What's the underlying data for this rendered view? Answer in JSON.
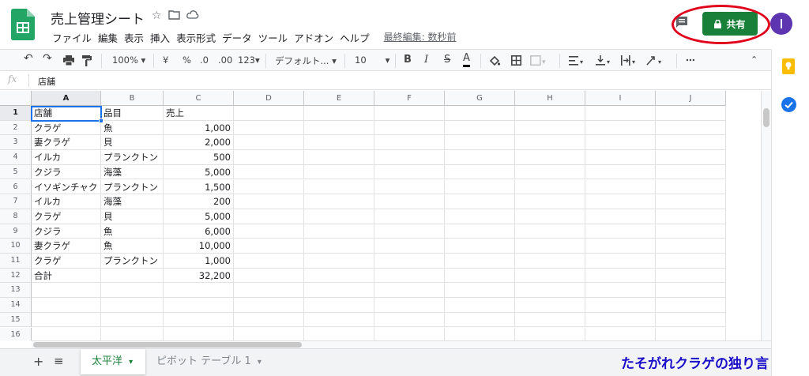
{
  "app": {
    "title": "売上管理シート"
  },
  "menu": [
    "ファイル",
    "編集",
    "表示",
    "挿入",
    "表示形式",
    "データ",
    "ツール",
    "アドオン",
    "ヘルプ"
  ],
  "last_edit": "最終編集: 数秒前",
  "share_label": "共有",
  "toolbar": {
    "zoom": "100%",
    "currency": "¥",
    "percent": "%",
    "dec_less": ".0",
    "dec_more": ".00",
    "format": "123",
    "font": "デフォルト...",
    "font_size": "10",
    "bold": "B",
    "italic": "I",
    "strike": "S",
    "color": "A"
  },
  "formula": {
    "label": "fx",
    "value": "店舗"
  },
  "columns": [
    "A",
    "B",
    "C",
    "D",
    "E",
    "F",
    "G",
    "H",
    "I",
    "J"
  ],
  "rows": [
    "1",
    "2",
    "3",
    "4",
    "5",
    "6",
    "7",
    "8",
    "9",
    "10",
    "11",
    "12",
    "13",
    "14",
    "15",
    "16"
  ],
  "cells": [
    [
      "店舗",
      "品目",
      "売上"
    ],
    [
      "クラゲ",
      "魚",
      "1,000"
    ],
    [
      "妻クラゲ",
      "貝",
      "2,000"
    ],
    [
      "イルカ",
      "プランクトン",
      "500"
    ],
    [
      "クジラ",
      "海藻",
      "5,000"
    ],
    [
      "イソギンチャク",
      "プランクトン",
      "1,500"
    ],
    [
      "イルカ",
      "海藻",
      "200"
    ],
    [
      "クラゲ",
      "貝",
      "5,000"
    ],
    [
      "クジラ",
      "魚",
      "6,000"
    ],
    [
      "妻クラゲ",
      "魚",
      "10,000"
    ],
    [
      "クラゲ",
      "プランクトン",
      "1,000"
    ],
    [
      "合計",
      "",
      "32,200"
    ]
  ],
  "sheet_tabs": {
    "add": "+",
    "list": "≡",
    "active": "太平洋",
    "other": "ピボット テーブル 1"
  },
  "watermark": "たそがれクラゲの独り言"
}
